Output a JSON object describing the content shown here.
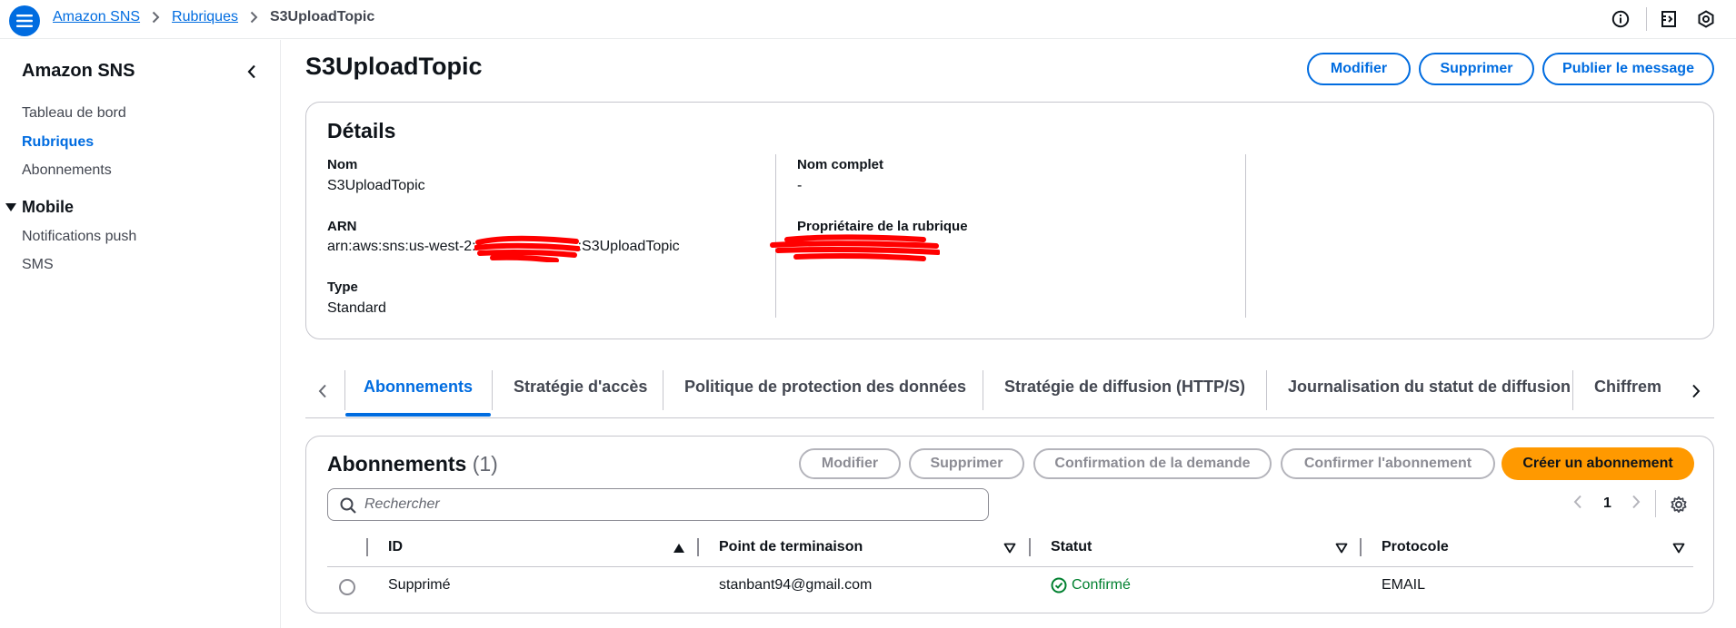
{
  "breadcrumb": {
    "items": [
      "Amazon SNS",
      "Rubriques"
    ],
    "current": "S3UploadTopic"
  },
  "icons": {
    "menu": "menu-icon",
    "info": "info-icon",
    "notes": "notes-icon",
    "settings_hex": "hexagon-settings-icon"
  },
  "sidebar": {
    "title": "Amazon SNS",
    "items": [
      "Tableau de bord",
      "Rubriques",
      "Abonnements"
    ],
    "active": "Rubriques",
    "section": "Mobile",
    "section_items": [
      "Notifications push",
      "SMS"
    ]
  },
  "header": {
    "title": "S3UploadTopic",
    "buttons": [
      "Modifier",
      "Supprimer",
      "Publier le message"
    ]
  },
  "details": {
    "title": "Détails",
    "name_label": "Nom",
    "name_value": "S3UploadTopic",
    "arn_label": "ARN",
    "arn_prefix": "arn:aws:sns:us-west-2:",
    "arn_suffix": ":S3UploadTopic",
    "type_label": "Type",
    "type_value": "Standard",
    "fullname_label": "Nom complet",
    "fullname_value": "-",
    "owner_label": "Propriétaire de la rubrique"
  },
  "tabs": [
    "Abonnements",
    "Stratégie d'accès",
    "Politique de protection des données",
    "Stratégie de diffusion (HTTP/S)",
    "Journalisation du statut de diffusion",
    "Chiffrem"
  ],
  "subscriptions": {
    "title": "Abonnements",
    "count": "(1)",
    "buttons": [
      "Modifier",
      "Supprimer",
      "Confirmation de la demande",
      "Confirmer l'abonnement"
    ],
    "create_button": "Créer un abonnement",
    "search_placeholder": "Rechercher",
    "page": "1",
    "columns": [
      "ID",
      "Point de terminaison",
      "Statut",
      "Protocole"
    ],
    "rows": [
      {
        "id": "Supprimé",
        "endpoint": "stanbant94@gmail.com",
        "status": "Confirmé",
        "protocol": "EMAIL"
      }
    ]
  },
  "colors": {
    "accent": "#006ce0",
    "primary_button": "#ff9900",
    "success": "#00802f",
    "redaction": "#ff0000"
  }
}
